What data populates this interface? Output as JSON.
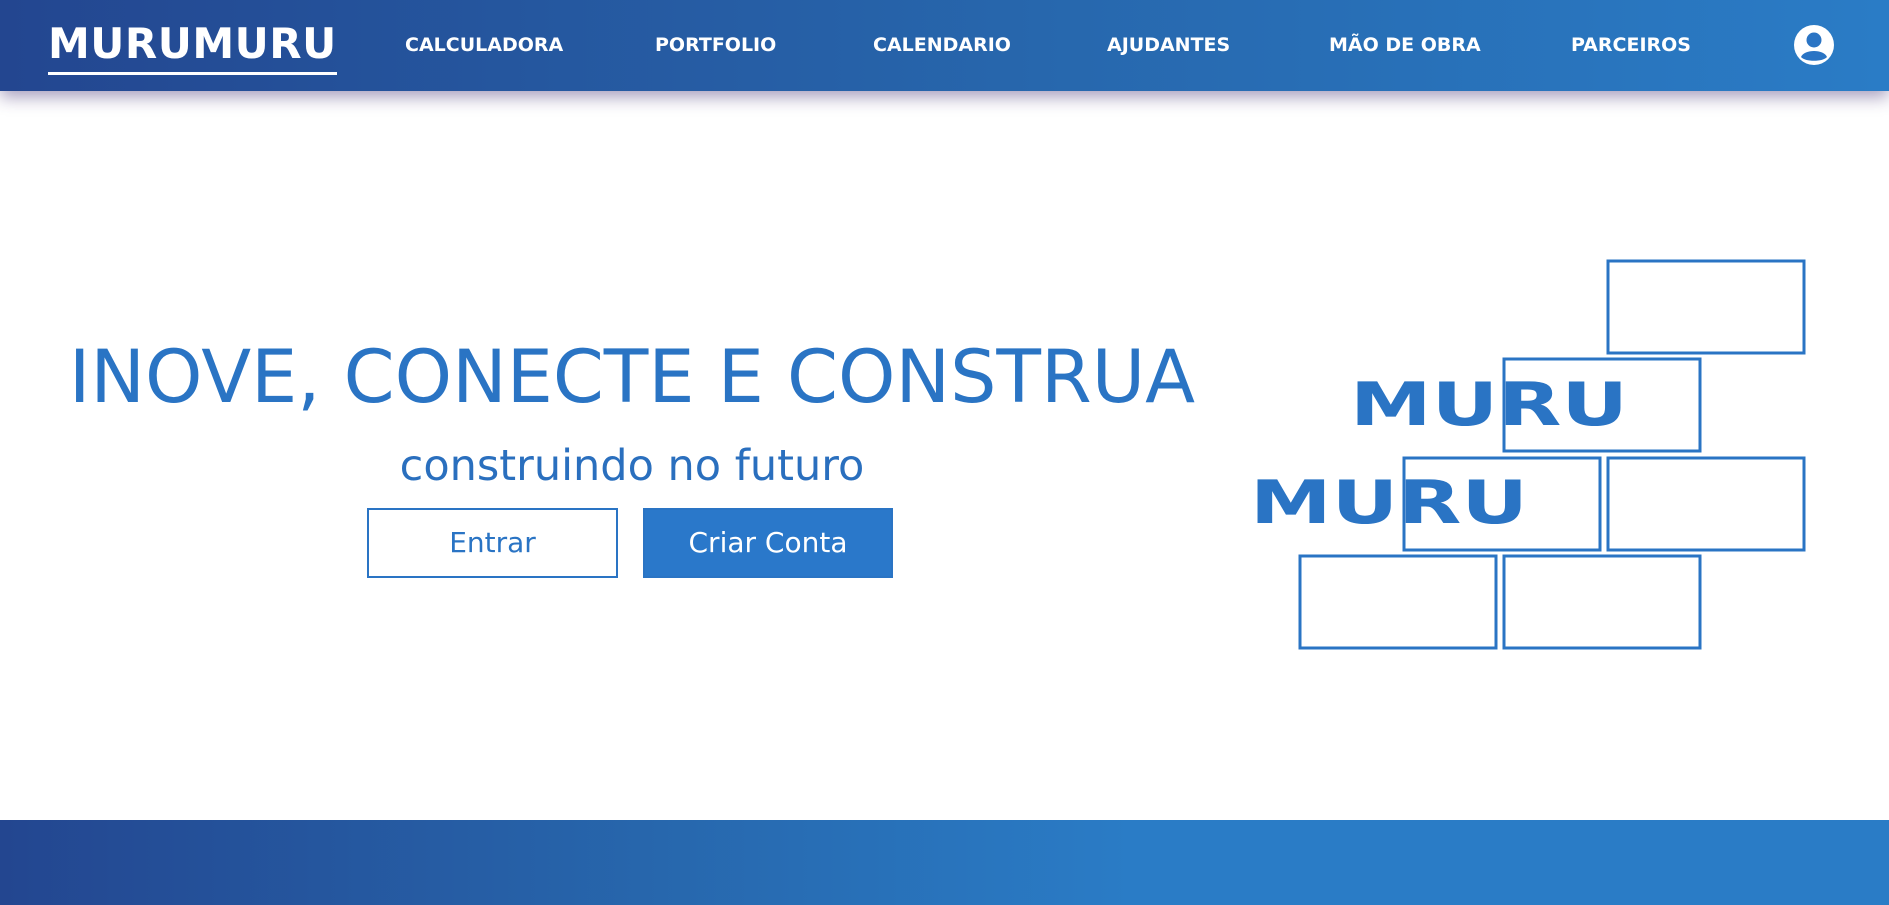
{
  "header": {
    "brand": "MURUMURU",
    "nav": [
      {
        "label": "CALCULADORA"
      },
      {
        "label": "PORTFOLIO"
      },
      {
        "label": "CALENDARIO"
      },
      {
        "label": "AJUDANTES"
      },
      {
        "label": "MÃO DE OBRA"
      },
      {
        "label": "PARCEIROS"
      }
    ],
    "user_icon": "user-circle-icon"
  },
  "hero": {
    "title": "INOVE, CONECTE E CONSTRUA",
    "subtitle": "construindo no futuro",
    "login_label": "Entrar",
    "signup_label": "Criar Conta"
  },
  "logo_art": {
    "word_top": "MURU",
    "word_bottom": "MURU"
  },
  "colors": {
    "accent": "#2a74c4",
    "nav_start": "#234690",
    "nav_end": "#2a7cc6"
  }
}
